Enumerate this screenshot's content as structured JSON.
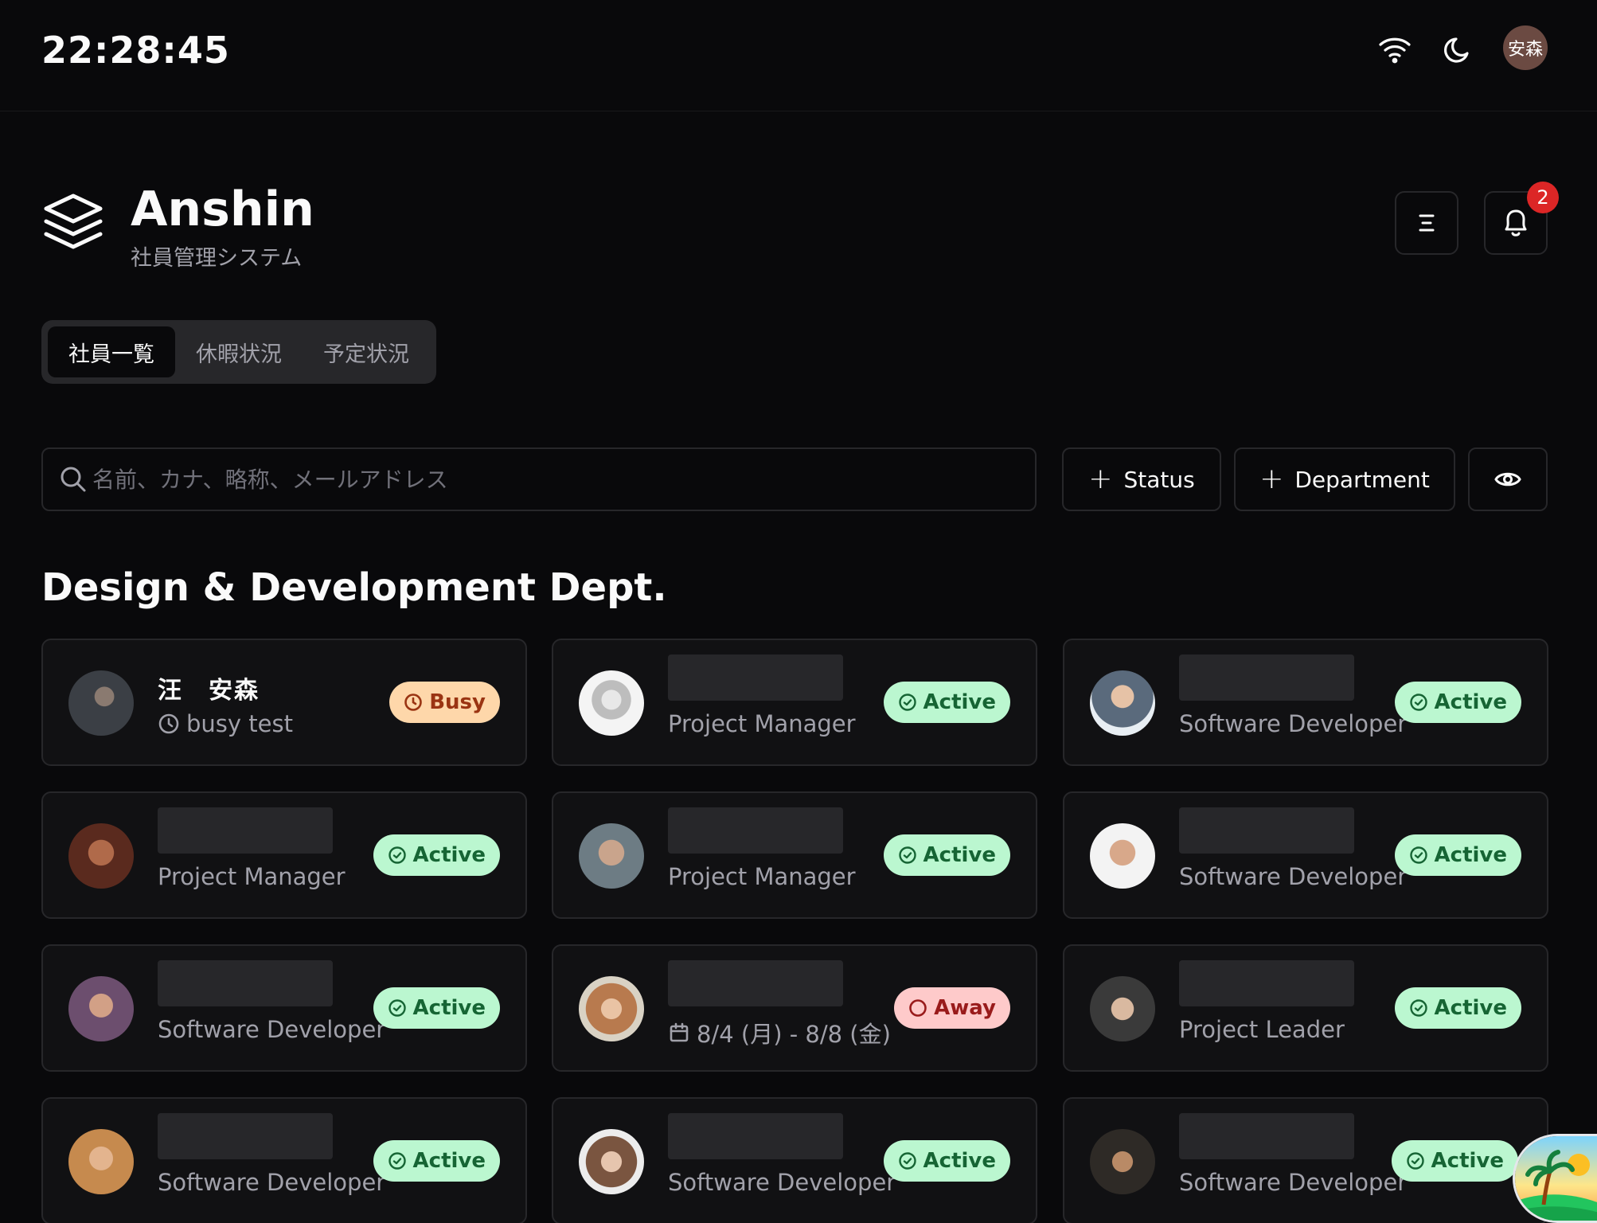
{
  "statusbar": {
    "clock": "22:28:45",
    "wifi_icon": "wifi-icon",
    "theme_icon": "moon-icon",
    "avatar_text": "安森"
  },
  "header": {
    "title": "Anshin",
    "subtitle": "社員管理システム",
    "logo_icon": "layers-icon",
    "notification_count": "2"
  },
  "tabs": [
    {
      "label": "社員一覧",
      "active": true
    },
    {
      "label": "休暇状況",
      "active": false
    },
    {
      "label": "予定状況",
      "active": false
    }
  ],
  "search": {
    "placeholder": "名前、カナ、略称、メールアドレス"
  },
  "filters": {
    "status_label": "Status",
    "department_label": "Department"
  },
  "section": {
    "title": "Design & Development Dept."
  },
  "employees": [
    {
      "name": "汪　安森",
      "role": "busy test",
      "role_icon": "clock-icon",
      "status": "Busy",
      "status_type": "busy"
    },
    {
      "name": "",
      "role": "Project Manager",
      "status": "Active",
      "status_type": "active"
    },
    {
      "name": "",
      "role": "Software Developer",
      "status": "Active",
      "status_type": "active"
    },
    {
      "name": "",
      "role": "Project Manager",
      "status": "Active",
      "status_type": "active"
    },
    {
      "name": "",
      "role": "Project Manager",
      "status": "Active",
      "status_type": "active"
    },
    {
      "name": "",
      "role": "Software Developer",
      "status": "Active",
      "status_type": "active"
    },
    {
      "name": "",
      "role": "Software Developer",
      "status": "Active",
      "status_type": "active"
    },
    {
      "name": "",
      "role": "8/4 (月) - 8/8 (金)",
      "role_icon": "calendar-icon",
      "status": "Away",
      "status_type": "away"
    },
    {
      "name": "",
      "role": "Project Leader",
      "status": "Active",
      "status_type": "active"
    },
    {
      "name": "",
      "role": "Software Developer",
      "status": "Active",
      "status_type": "active"
    },
    {
      "name": "",
      "role": "Software Developer",
      "status": "Active",
      "status_type": "active"
    },
    {
      "name": "",
      "role": "Software Developer",
      "status": "Active",
      "status_type": "active"
    }
  ],
  "colors": {
    "background": "#09090b",
    "card": "#111113",
    "border": "#27272a",
    "active_badge": "#bbf7d0",
    "busy_badge": "#fed7aa",
    "away_badge": "#fecaca",
    "notification": "#dc2626"
  }
}
